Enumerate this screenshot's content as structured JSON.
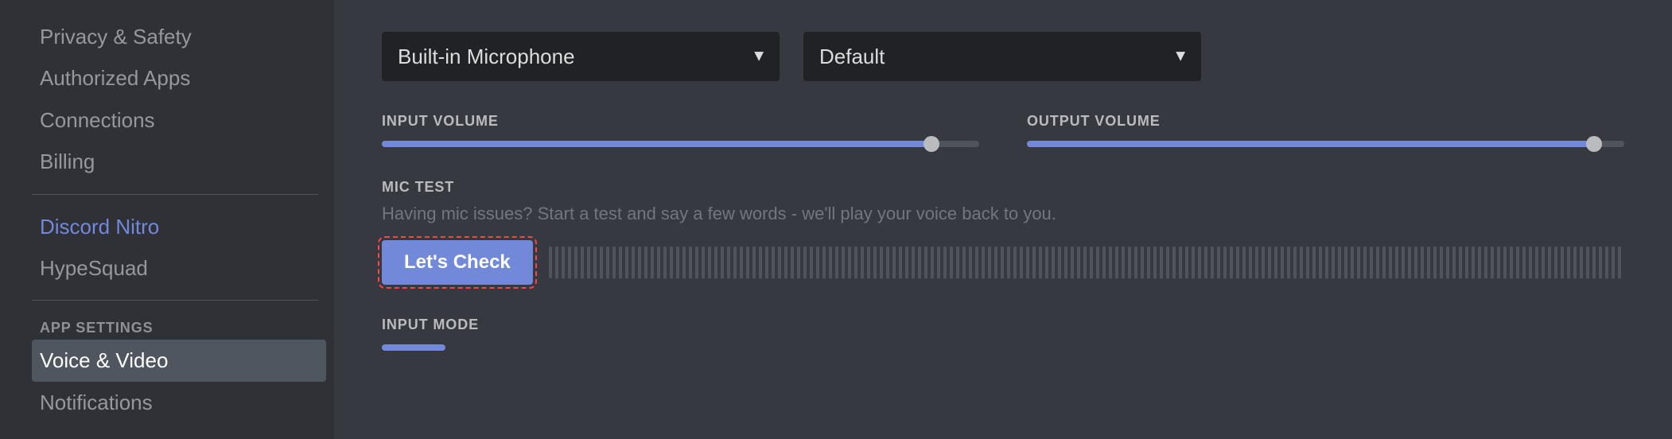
{
  "sidebar": {
    "items": [
      {
        "id": "privacy-safety",
        "label": "Privacy & Safety",
        "state": "normal"
      },
      {
        "id": "authorized-apps",
        "label": "Authorized Apps",
        "state": "normal"
      },
      {
        "id": "connections",
        "label": "Connections",
        "state": "normal"
      },
      {
        "id": "billing",
        "label": "Billing",
        "state": "normal"
      },
      {
        "divider": true
      },
      {
        "id": "discord-nitro",
        "label": "Discord Nitro",
        "state": "accent"
      },
      {
        "id": "hypesquad",
        "label": "HypeSquad",
        "state": "normal"
      },
      {
        "divider": true
      },
      {
        "id": "app-settings-label",
        "label": "APP SETTINGS",
        "type": "section"
      },
      {
        "id": "voice-video",
        "label": "Voice & Video",
        "state": "active"
      },
      {
        "id": "notifications",
        "label": "Notifications",
        "state": "normal"
      }
    ]
  },
  "main": {
    "microphone": {
      "label": "Built-in Microphone",
      "arrow": "▼"
    },
    "output": {
      "label": "Default",
      "arrow": "▼"
    },
    "input_volume": {
      "label": "INPUT VOLUME",
      "fill_pct": 92
    },
    "output_volume": {
      "label": "OUTPUT VOLUME",
      "fill_pct": 95
    },
    "mic_test": {
      "label": "MIC TEST",
      "description": "Having mic issues? Start a test and say a few words - we'll play your voice back to you.",
      "button": "Let's Check"
    },
    "input_mode": {
      "label": "INPUT MODE"
    }
  }
}
